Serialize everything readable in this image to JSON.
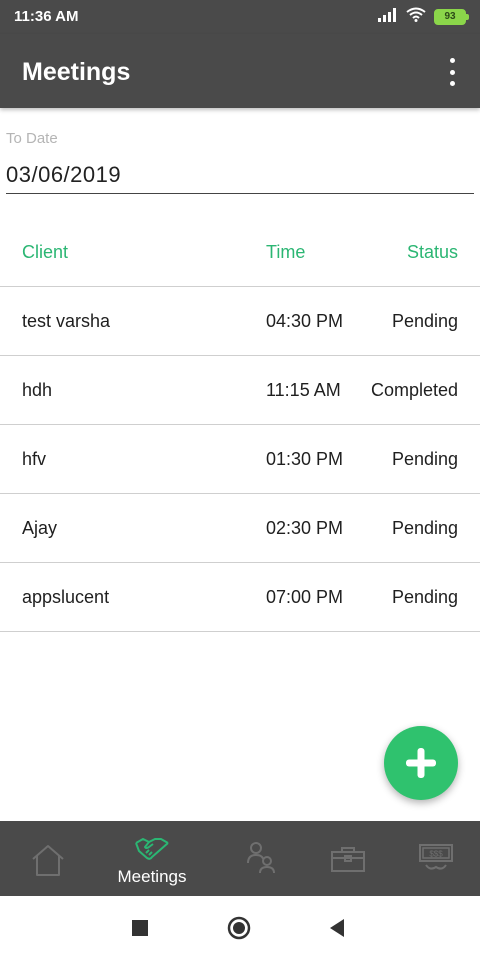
{
  "status_bar": {
    "time": "11:36 AM",
    "battery": "93"
  },
  "app_bar": {
    "title": "Meetings",
    "menu_icon": "more-vert-icon"
  },
  "date_field": {
    "label": "To Date",
    "value": "03/06/2019"
  },
  "table": {
    "headers": {
      "client": "Client",
      "time": "Time",
      "status": "Status"
    },
    "rows": [
      {
        "client": "test varsha",
        "time": "04:30 PM",
        "status": "Pending"
      },
      {
        "client": "hdh",
        "time": "11:15 AM",
        "status": "Completed"
      },
      {
        "client": "hfv",
        "time": "01:30 PM",
        "status": "Pending"
      },
      {
        "client": "Ajay",
        "time": "02:30 PM",
        "status": "Pending"
      },
      {
        "client": "appslucent",
        "time": "07:00 PM",
        "status": "Pending"
      }
    ]
  },
  "fab": {
    "icon": "plus-icon"
  },
  "bottom_nav": {
    "items": [
      {
        "icon": "home-icon",
        "label": ""
      },
      {
        "icon": "handshake-icon",
        "label": "Meetings",
        "active": true
      },
      {
        "icon": "contacts-icon",
        "label": ""
      },
      {
        "icon": "briefcase-icon",
        "label": ""
      },
      {
        "icon": "money-icon",
        "label": ""
      }
    ]
  },
  "colors": {
    "bar": "#4a4a4a",
    "accent": "#2bb673",
    "fab": "#2fc26e",
    "battery": "#8bd64a"
  }
}
